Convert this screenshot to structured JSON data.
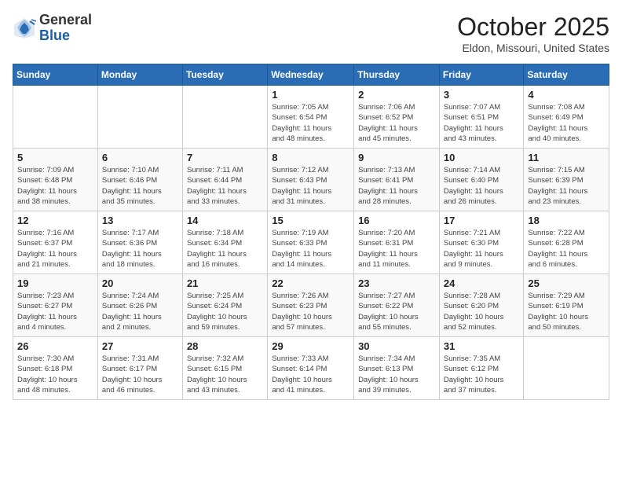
{
  "header": {
    "logo_general": "General",
    "logo_blue": "Blue",
    "month_title": "October 2025",
    "location": "Eldon, Missouri, United States"
  },
  "days_of_week": [
    "Sunday",
    "Monday",
    "Tuesday",
    "Wednesday",
    "Thursday",
    "Friday",
    "Saturday"
  ],
  "weeks": [
    [
      {
        "day": "",
        "info": ""
      },
      {
        "day": "",
        "info": ""
      },
      {
        "day": "",
        "info": ""
      },
      {
        "day": "1",
        "info": "Sunrise: 7:05 AM\nSunset: 6:54 PM\nDaylight: 11 hours\nand 48 minutes."
      },
      {
        "day": "2",
        "info": "Sunrise: 7:06 AM\nSunset: 6:52 PM\nDaylight: 11 hours\nand 45 minutes."
      },
      {
        "day": "3",
        "info": "Sunrise: 7:07 AM\nSunset: 6:51 PM\nDaylight: 11 hours\nand 43 minutes."
      },
      {
        "day": "4",
        "info": "Sunrise: 7:08 AM\nSunset: 6:49 PM\nDaylight: 11 hours\nand 40 minutes."
      }
    ],
    [
      {
        "day": "5",
        "info": "Sunrise: 7:09 AM\nSunset: 6:48 PM\nDaylight: 11 hours\nand 38 minutes."
      },
      {
        "day": "6",
        "info": "Sunrise: 7:10 AM\nSunset: 6:46 PM\nDaylight: 11 hours\nand 35 minutes."
      },
      {
        "day": "7",
        "info": "Sunrise: 7:11 AM\nSunset: 6:44 PM\nDaylight: 11 hours\nand 33 minutes."
      },
      {
        "day": "8",
        "info": "Sunrise: 7:12 AM\nSunset: 6:43 PM\nDaylight: 11 hours\nand 31 minutes."
      },
      {
        "day": "9",
        "info": "Sunrise: 7:13 AM\nSunset: 6:41 PM\nDaylight: 11 hours\nand 28 minutes."
      },
      {
        "day": "10",
        "info": "Sunrise: 7:14 AM\nSunset: 6:40 PM\nDaylight: 11 hours\nand 26 minutes."
      },
      {
        "day": "11",
        "info": "Sunrise: 7:15 AM\nSunset: 6:39 PM\nDaylight: 11 hours\nand 23 minutes."
      }
    ],
    [
      {
        "day": "12",
        "info": "Sunrise: 7:16 AM\nSunset: 6:37 PM\nDaylight: 11 hours\nand 21 minutes."
      },
      {
        "day": "13",
        "info": "Sunrise: 7:17 AM\nSunset: 6:36 PM\nDaylight: 11 hours\nand 18 minutes."
      },
      {
        "day": "14",
        "info": "Sunrise: 7:18 AM\nSunset: 6:34 PM\nDaylight: 11 hours\nand 16 minutes."
      },
      {
        "day": "15",
        "info": "Sunrise: 7:19 AM\nSunset: 6:33 PM\nDaylight: 11 hours\nand 14 minutes."
      },
      {
        "day": "16",
        "info": "Sunrise: 7:20 AM\nSunset: 6:31 PM\nDaylight: 11 hours\nand 11 minutes."
      },
      {
        "day": "17",
        "info": "Sunrise: 7:21 AM\nSunset: 6:30 PM\nDaylight: 11 hours\nand 9 minutes."
      },
      {
        "day": "18",
        "info": "Sunrise: 7:22 AM\nSunset: 6:28 PM\nDaylight: 11 hours\nand 6 minutes."
      }
    ],
    [
      {
        "day": "19",
        "info": "Sunrise: 7:23 AM\nSunset: 6:27 PM\nDaylight: 11 hours\nand 4 minutes."
      },
      {
        "day": "20",
        "info": "Sunrise: 7:24 AM\nSunset: 6:26 PM\nDaylight: 11 hours\nand 2 minutes."
      },
      {
        "day": "21",
        "info": "Sunrise: 7:25 AM\nSunset: 6:24 PM\nDaylight: 10 hours\nand 59 minutes."
      },
      {
        "day": "22",
        "info": "Sunrise: 7:26 AM\nSunset: 6:23 PM\nDaylight: 10 hours\nand 57 minutes."
      },
      {
        "day": "23",
        "info": "Sunrise: 7:27 AM\nSunset: 6:22 PM\nDaylight: 10 hours\nand 55 minutes."
      },
      {
        "day": "24",
        "info": "Sunrise: 7:28 AM\nSunset: 6:20 PM\nDaylight: 10 hours\nand 52 minutes."
      },
      {
        "day": "25",
        "info": "Sunrise: 7:29 AM\nSunset: 6:19 PM\nDaylight: 10 hours\nand 50 minutes."
      }
    ],
    [
      {
        "day": "26",
        "info": "Sunrise: 7:30 AM\nSunset: 6:18 PM\nDaylight: 10 hours\nand 48 minutes."
      },
      {
        "day": "27",
        "info": "Sunrise: 7:31 AM\nSunset: 6:17 PM\nDaylight: 10 hours\nand 46 minutes."
      },
      {
        "day": "28",
        "info": "Sunrise: 7:32 AM\nSunset: 6:15 PM\nDaylight: 10 hours\nand 43 minutes."
      },
      {
        "day": "29",
        "info": "Sunrise: 7:33 AM\nSunset: 6:14 PM\nDaylight: 10 hours\nand 41 minutes."
      },
      {
        "day": "30",
        "info": "Sunrise: 7:34 AM\nSunset: 6:13 PM\nDaylight: 10 hours\nand 39 minutes."
      },
      {
        "day": "31",
        "info": "Sunrise: 7:35 AM\nSunset: 6:12 PM\nDaylight: 10 hours\nand 37 minutes."
      },
      {
        "day": "",
        "info": ""
      }
    ]
  ]
}
